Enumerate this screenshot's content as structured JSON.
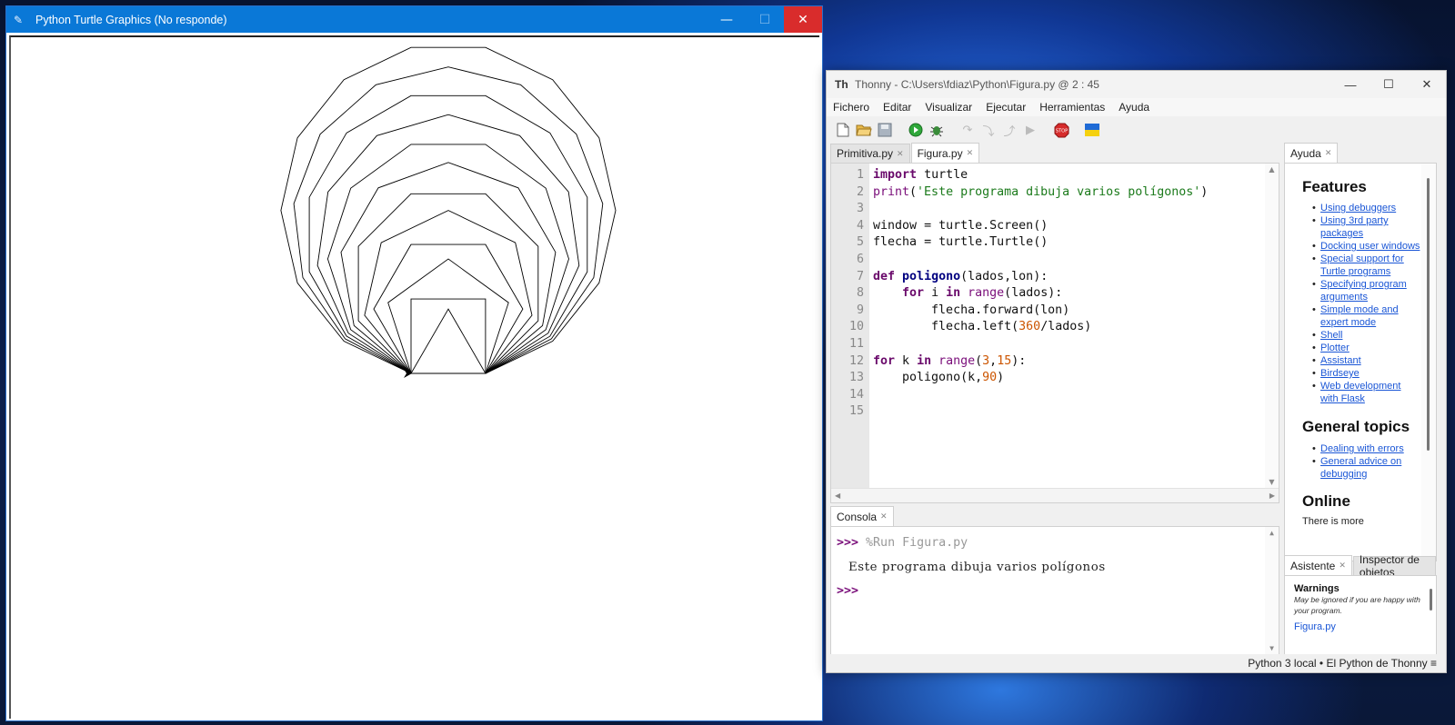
{
  "turtle_window": {
    "title": "Python Turtle Graphics (No responde)",
    "icon": "feather-icon",
    "program": {
      "sides_start": 3,
      "sides_end": 15,
      "side_length": 90
    }
  },
  "thonny": {
    "title": "Thonny  -  C:\\Users\\fdiaz\\Python\\Figura.py  @  2 : 45",
    "menu": [
      "Fichero",
      "Editar",
      "Visualizar",
      "Ejecutar",
      "Herramientas",
      "Ayuda"
    ],
    "toolbar": [
      "new-file-icon",
      "open-file-icon",
      "save-icon",
      "run-icon",
      "debug-icon",
      "step-over-icon",
      "step-into-icon",
      "step-out-icon",
      "resume-icon",
      "stop-icon",
      "ukraine-flag-icon"
    ],
    "colors": {
      "keyword": "#6a0a6b",
      "string": "#1b7a1b",
      "number": "#cc5500",
      "link": "#1a56d6"
    },
    "editor": {
      "tabs": [
        {
          "label": "Primitiva.py",
          "active": false
        },
        {
          "label": "Figura.py",
          "active": true
        }
      ],
      "line_numbers": [
        "1",
        "2",
        "3",
        "4",
        "5",
        "6",
        "7",
        "8",
        "9",
        "10",
        "11",
        "12",
        "13",
        "14",
        "15"
      ],
      "code": [
        "import turtle",
        "print('Este programa dibuja varios polígonos')",
        "",
        "window = turtle.Screen()",
        "flecha = turtle.Turtle()",
        "",
        "def poligono(lados,lon):",
        "    for i in range(lados):",
        "        flecha.forward(lon)",
        "        flecha.left(360/lados)",
        "",
        "for k in range(3,15):",
        "    poligono(k,90)",
        "",
        ""
      ]
    },
    "console": {
      "tab": "Consola",
      "prompt": ">>>",
      "command": "%Run Figura.py",
      "output": "Este programa dibuja varios polígonos",
      "prompt2": ">>>"
    },
    "help": {
      "tab": "Ayuda",
      "heading1": "Features",
      "features": [
        "Using debuggers",
        "Using 3rd party packages",
        "Docking user windows",
        "Special support for Turtle programs",
        "Specifying program arguments",
        "Simple mode and expert mode",
        "Shell",
        "Plotter",
        "Assistant",
        "Birdseye",
        "Web development with Flask"
      ],
      "heading2": "General topics",
      "general": [
        "Dealing with errors",
        "General advice on debugging"
      ],
      "heading3": "Online",
      "online_text": "There is more"
    },
    "assistant": {
      "tabs": [
        "Asistente",
        "Inspector de objetos"
      ],
      "warnings_title": "Warnings",
      "warnings_text": "May be ignored if you are happy with your program.",
      "file_link": "Figura.py"
    },
    "status": "Python 3 local  •  El Python de Thonny  ≡"
  }
}
